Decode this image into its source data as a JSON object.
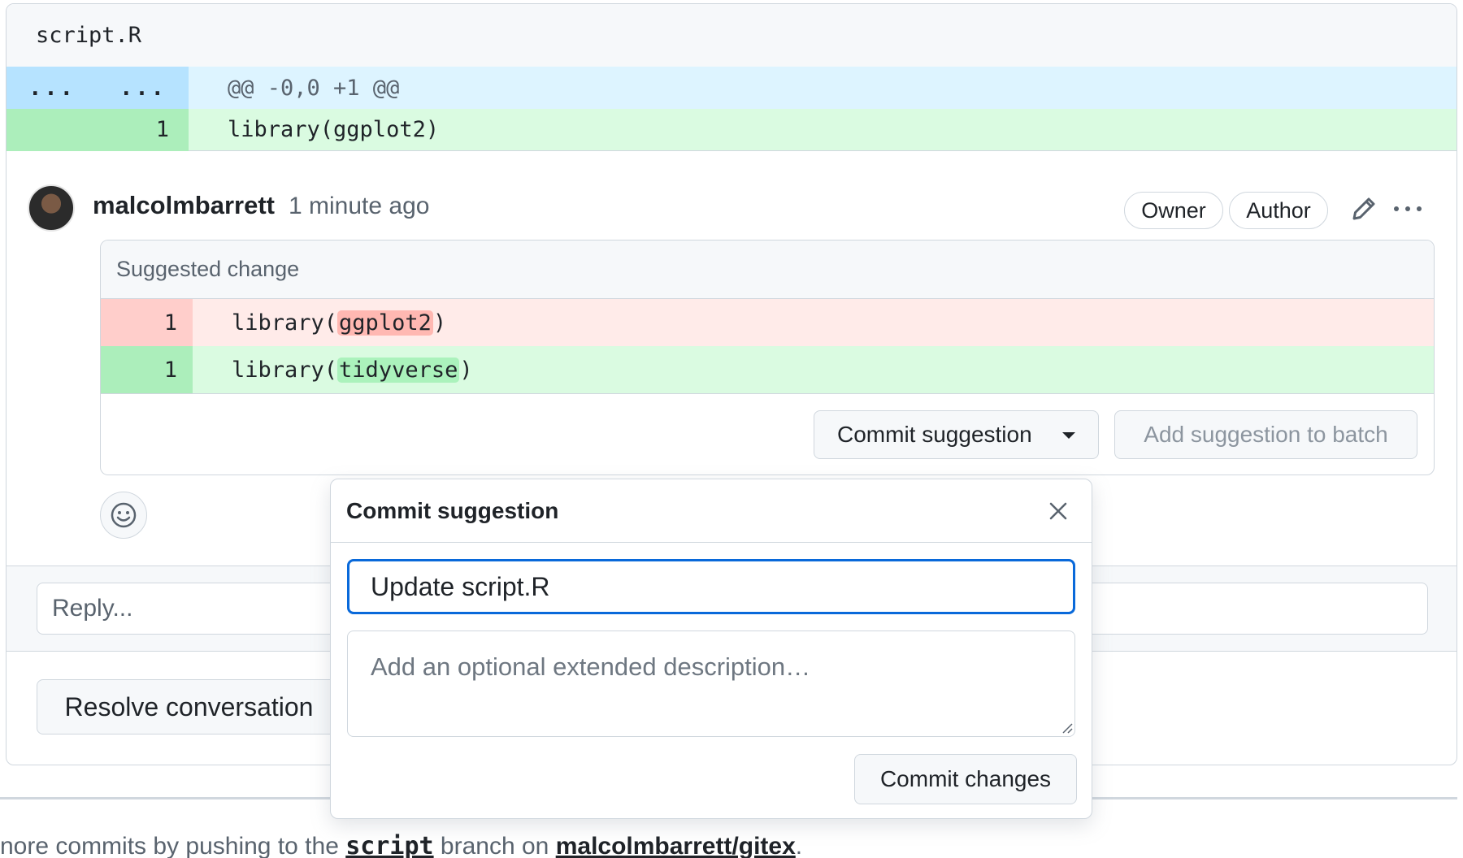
{
  "file": {
    "name": "script.R",
    "hunk": {
      "left_marker": "...",
      "right_marker": "...",
      "header": "@@ -0,0 +1 @@"
    },
    "added_line": {
      "number": "1",
      "code": "library(ggplot2)"
    }
  },
  "comment": {
    "author": "malcolmbarrett",
    "time": "1 minute ago",
    "badges": [
      "Owner",
      "Author"
    ],
    "suggestion": {
      "header": "Suggested change",
      "removed": {
        "number": "1",
        "prefix": "library(",
        "highlight": "ggplot2",
        "suffix": ")"
      },
      "added": {
        "number": "1",
        "prefix": "library(",
        "highlight": "tidyverse",
        "suffix": ")"
      },
      "commit_button": "Commit suggestion",
      "batch_button": "Add suggestion to batch"
    }
  },
  "reply": {
    "placeholder": "Reply..."
  },
  "resolve_button": "Resolve conversation",
  "footer": {
    "prefix": "nore commits by pushing to the ",
    "branch": "script",
    "middle": " branch on ",
    "repo": "malcolmbarrett/gitex",
    "suffix": "."
  },
  "popover": {
    "title": "Commit suggestion",
    "message_value": "Update script.R",
    "description_placeholder": "Add an optional extended description…",
    "commit_button": "Commit changes"
  },
  "icons": {
    "pencil": "pencil-icon",
    "more": "kebab-horizontal-icon",
    "emoji": "smiley-icon",
    "close": "x-icon",
    "caret": "triangle-down-icon"
  }
}
